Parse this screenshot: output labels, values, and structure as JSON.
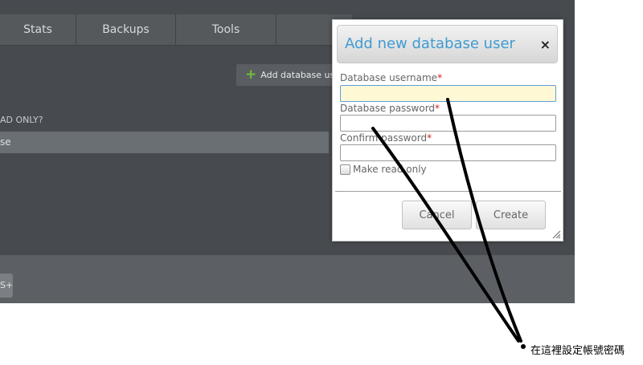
{
  "tabs": [
    {
      "label": "Stats"
    },
    {
      "label": "Backups"
    },
    {
      "label": "Tools"
    },
    {
      "label": ""
    }
  ],
  "add_user_button": {
    "label": "Add database user",
    "icon": "plus-icon"
  },
  "table": {
    "readonly_header": "AD ONLY?",
    "row_text": "se"
  },
  "footer": {
    "button_glyph": "S+"
  },
  "dialog": {
    "title": "Add new database user",
    "close_glyph": "×",
    "required_marker": "*",
    "fields": [
      {
        "label": "Database username",
        "value": "",
        "focused": true
      },
      {
        "label": "Database password",
        "value": ""
      },
      {
        "label": "Confirm password",
        "value": ""
      }
    ],
    "readonly_checkbox": {
      "label": "Make read only",
      "checked": false
    },
    "cancel_label": "Cancel",
    "create_label": "Create"
  },
  "annotation": {
    "note": "在這裡設定帳號密碼"
  },
  "colors": {
    "accent": "#3f9bd1",
    "panel": "#474b4f",
    "plus": "#6fbf3a",
    "required": "#cc2222"
  }
}
